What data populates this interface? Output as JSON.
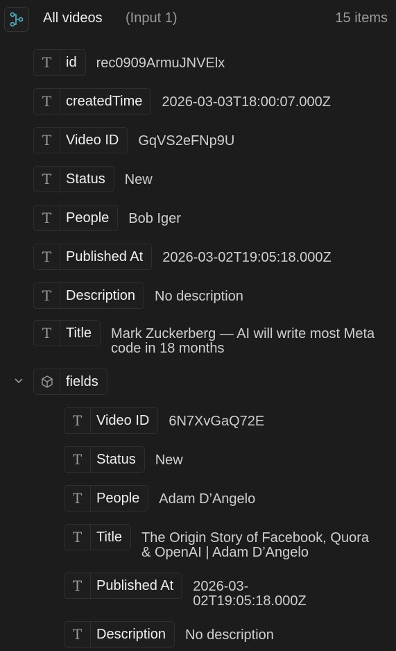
{
  "header": {
    "title": "All videos",
    "subtitle": "(Input 1)",
    "count": "15 items",
    "icon": "branch-node-icon"
  },
  "fields_top": [
    {
      "key": "id",
      "value": "rec0909ArmuJNVElx"
    },
    {
      "key": "createdTime",
      "value": "2026-03-03T18:00:07.000Z"
    },
    {
      "key": "Video ID",
      "value": "GqVS2eFNp9U"
    },
    {
      "key": "Status",
      "value": "New"
    },
    {
      "key": "People",
      "value": "Bob Iger"
    },
    {
      "key": "Published At",
      "value": "2026-03-02T19:05:18.000Z"
    },
    {
      "key": "Description",
      "value": "No description"
    },
    {
      "key": "Title",
      "value": "Mark Zuckerberg — AI will write most Meta code in 18 months"
    }
  ],
  "group": {
    "key": "fields",
    "icon": "cube-icon",
    "expanded": true
  },
  "fields_nested": [
    {
      "key": "Video ID",
      "value": "6N7XvGaQ72E"
    },
    {
      "key": "Status",
      "value": "New"
    },
    {
      "key": "People",
      "value": "Adam D’Angelo"
    },
    {
      "key": "Title",
      "value": "The Origin Story of Facebook, Quora & OpenAI | Adam D’Angelo"
    },
    {
      "key": "Published At",
      "value": "2026-03-02T19:05:18.000Z"
    },
    {
      "key": "Description",
      "value": "No description"
    }
  ],
  "type_glyph": "T",
  "colors": {
    "background": "#1c1c1c",
    "accent": "#4fb6c9",
    "text": "#d4d4d4",
    "muted": "#9a9a9a"
  }
}
